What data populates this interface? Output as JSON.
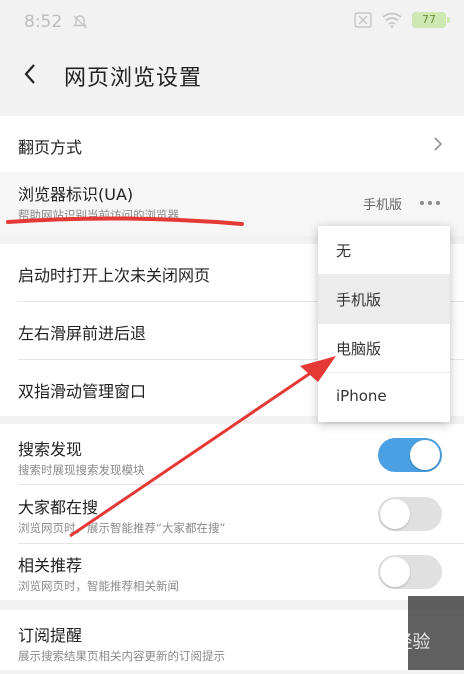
{
  "status": {
    "time": "8:52",
    "battery": "77"
  },
  "header": {
    "title": "网页浏览设置"
  },
  "rows": {
    "page_turn": {
      "title": "翻页方式"
    },
    "ua": {
      "title": "浏览器标识(UA)",
      "subtitle": "帮助网站识别当前访问的浏览器",
      "value": "手机版"
    },
    "restore": {
      "title": "启动时打开上次未关闭网页"
    },
    "swipe": {
      "title": "左右滑屏前进后退"
    },
    "twofinger": {
      "title": "双指滑动管理窗口"
    },
    "search_discover": {
      "title": "搜索发现",
      "subtitle": "搜索时展现搜索发现模块",
      "enabled": true
    },
    "everyone_search": {
      "title": "大家都在搜",
      "subtitle": "浏览网页时，展示智能推荐“大家都在搜”",
      "enabled": false
    },
    "related": {
      "title": "相关推荐",
      "subtitle": "浏览网页时，智能推荐相关新闻",
      "enabled": false
    },
    "subscription": {
      "title": "订阅提醒",
      "subtitle": "展示搜索结果页相关内容更新的订阅提示"
    }
  },
  "dropdown": {
    "options": [
      "无",
      "手机版",
      "电脑版",
      "iPhone"
    ],
    "selected": "手机版"
  },
  "watermark": {
    "text": "Bai经验"
  },
  "colors": {
    "accent": "#4aa0e2",
    "annotation": "#e53935"
  }
}
